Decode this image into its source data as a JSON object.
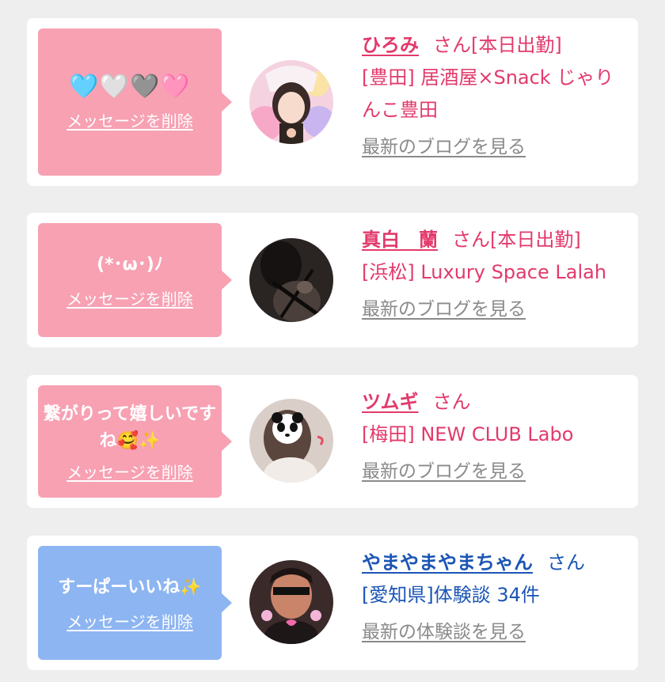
{
  "delete_label": "メッセージを削除",
  "suffix": "さん",
  "items": [
    {
      "message": "🩵🤍🩶🩷",
      "name": "ひろみ",
      "status": "[本日出勤]",
      "shop": "[豊田] 居酒屋×Snack じゃりんこ豊田",
      "link": "最新のブログを見る",
      "bubble_color": "#f7a1b3",
      "text_color": "#e23a6b"
    },
    {
      "message": "(*･ω･)ﾉ",
      "name": "真白　蘭",
      "status": "[本日出勤]",
      "shop": "[浜松] Luxury Space Lalah",
      "link": "最新のブログを見る",
      "bubble_color": "#f7a1b3",
      "text_color": "#e23a6b"
    },
    {
      "message": "繋がりって嬉しいですね🥰✨",
      "name": "ツムギ",
      "status": "",
      "shop": "[梅田] NEW CLUB Labo",
      "link": "最新のブログを見る",
      "bubble_color": "#f7a1b3",
      "text_color": "#e23a6b"
    },
    {
      "message": "すーぱーいいね✨",
      "name": "やまやまやまちゃん",
      "status": "",
      "shop": "[愛知県]体験談 34件",
      "link": "最新の体験談を見る",
      "bubble_color": "#8db5f2",
      "text_color": "#1b55b5"
    }
  ]
}
